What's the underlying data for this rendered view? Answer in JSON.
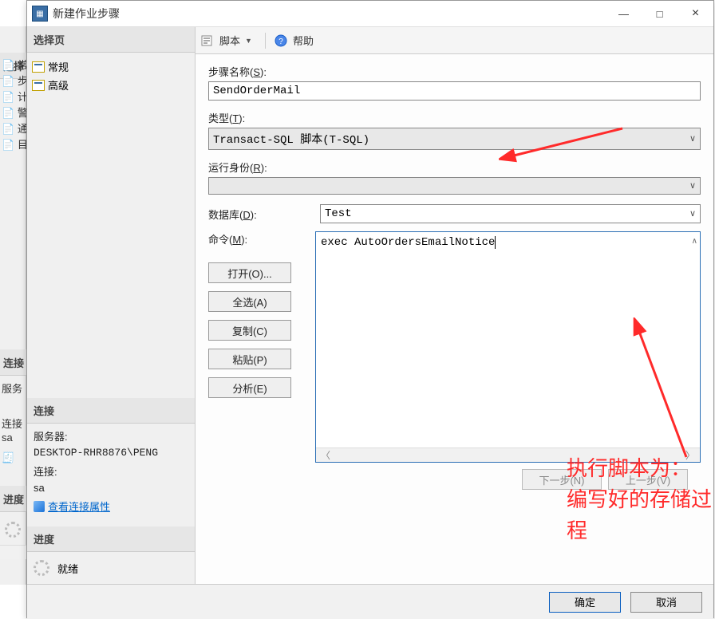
{
  "bg_panel": {
    "header": "选择",
    "items": [
      "常",
      "步",
      "计",
      "警",
      "通",
      "目"
    ],
    "conn_header": "连接",
    "server_label": "服务",
    "conn_label": "连接",
    "sa": "sa",
    "link_icon_item": "🧾",
    "progress_header": "进度"
  },
  "dialog": {
    "title": "新建作业步骤",
    "minimize": "—",
    "maximize": "□",
    "close": "×"
  },
  "left": {
    "select_header": "选择页",
    "pages": [
      "常规",
      "高级"
    ],
    "conn_header": "连接",
    "server_label": "服务器:",
    "server_value": "DESKTOP-RHR8876\\PENG",
    "conn_label": "连接:",
    "conn_value": "sa",
    "view_props": "查看连接属性",
    "progress_header": "进度",
    "progress_status": "就绪"
  },
  "toolbar": {
    "script_label": "脚本",
    "help_label": "帮助"
  },
  "form": {
    "step_name_label_pre": "步骤名称(",
    "step_name_key": "S",
    "step_name_label_post": "):",
    "step_name_value": "SendOrderMail",
    "type_label_pre": "类型(",
    "type_key": "T",
    "type_label_post": "):",
    "type_value": "Transact-SQL 脚本(T-SQL)",
    "runas_label_pre": "运行身份(",
    "runas_key": "R",
    "runas_label_post": "):",
    "runas_value": "",
    "db_label_pre": "数据库(",
    "db_key": "D",
    "db_label_post": ":",
    "db_value": "Test",
    "cmd_label_pre": "命令(",
    "cmd_key": "M",
    "cmd_label_post": "):",
    "cmd_value": "exec AutoOrdersEmailNotice",
    "btn_open": "打开(O)...",
    "btn_selectall": "全选(A)",
    "btn_copy": "复制(C)",
    "btn_paste": "粘贴(P)",
    "btn_parse": "分析(E)",
    "nav_next": "下一步(N)",
    "nav_prev": "上一步(V)"
  },
  "buttons": {
    "ok": "确定",
    "cancel": "取消"
  },
  "annotation": {
    "line1": "执行脚本为：",
    "line2": "编写好的存储过程"
  }
}
